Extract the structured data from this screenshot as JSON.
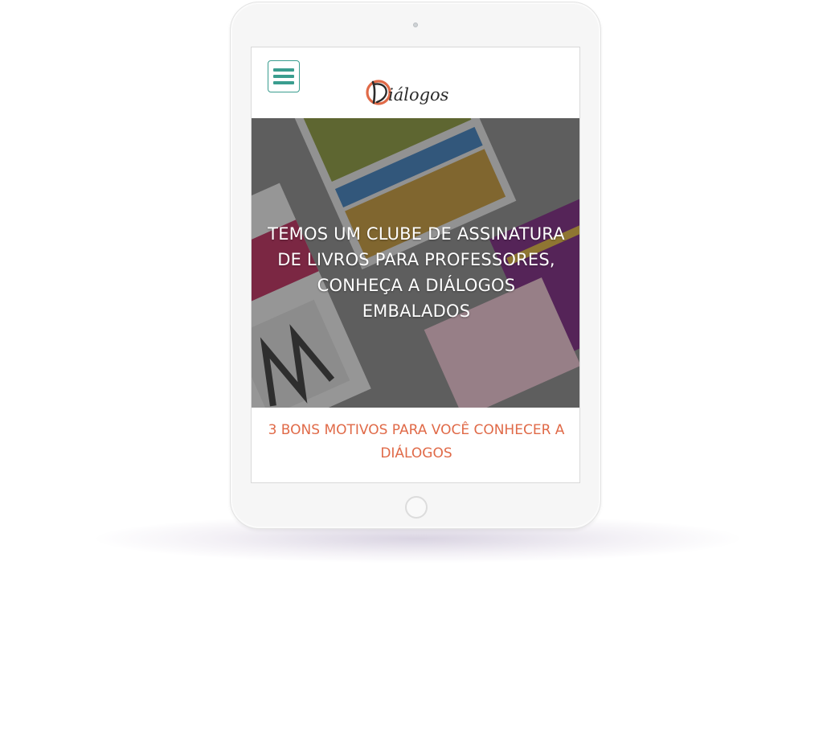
{
  "brand": {
    "name": "Diálogos",
    "accent_color": "#e06a48",
    "menu_color": "#3a9d8f"
  },
  "header": {
    "menu_icon": "hamburger-menu-icon"
  },
  "hero": {
    "headline": "TEMOS UM CLUBE DE ASSINATURA DE LIVROS PARA PROFESSORES, CONHEÇA A DIÁLOGOS EMBALADOS",
    "background": "books-collage-image"
  },
  "section": {
    "title": "3 BONS MOTIVOS PARA VOCÊ CONHECER A DIÁLOGOS"
  },
  "device": {
    "type": "tablet",
    "home_button_icon": "home-button-icon"
  }
}
